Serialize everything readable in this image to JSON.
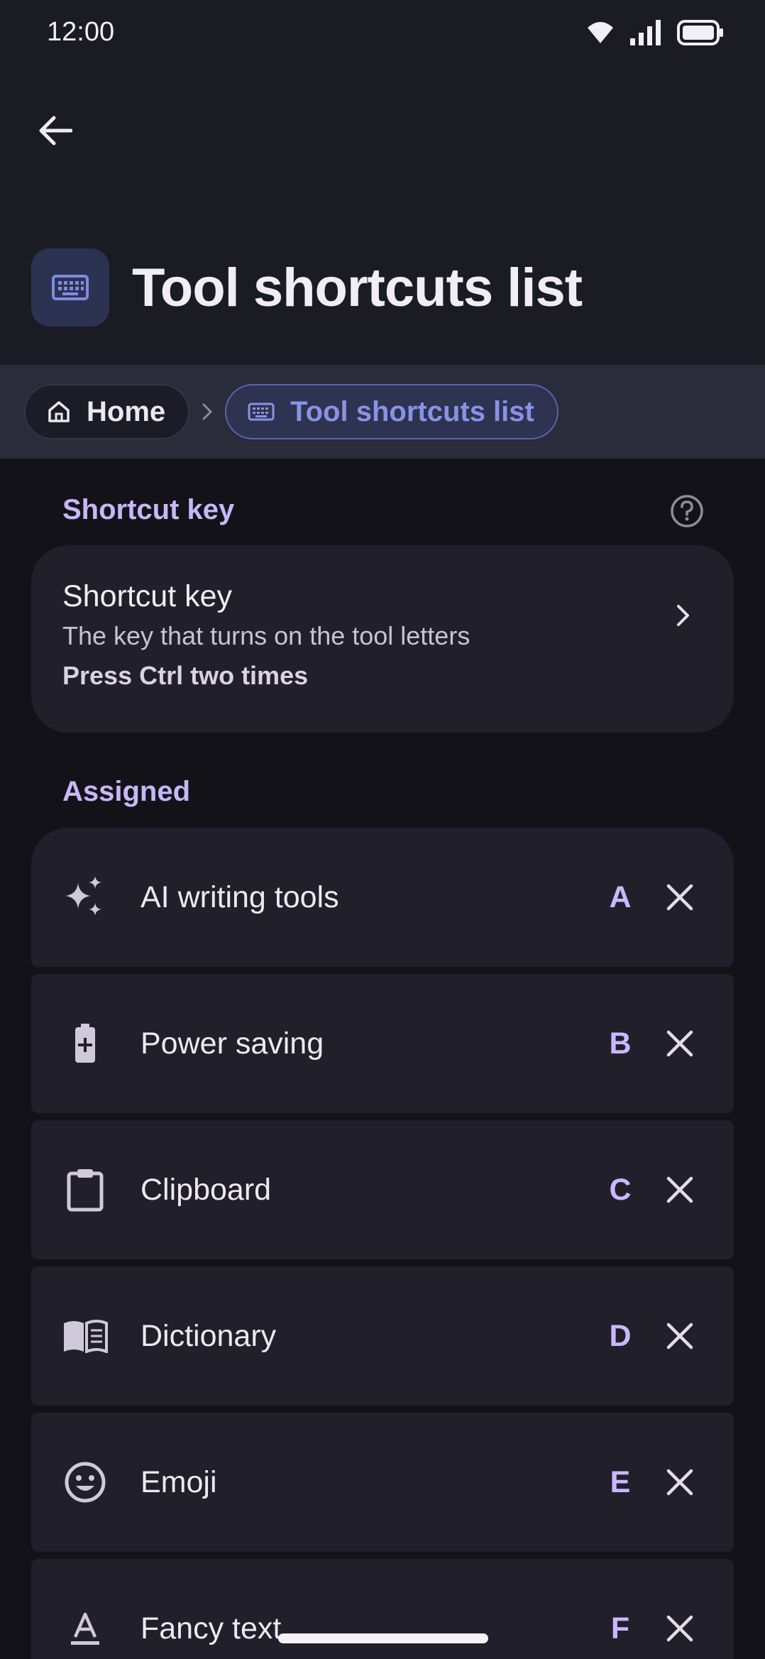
{
  "status_bar": {
    "time": "12:00"
  },
  "header": {
    "title": "Tool shortcuts list"
  },
  "breadcrumb": {
    "home_label": "Home",
    "current_label": "Tool shortcuts list"
  },
  "shortcut_section": {
    "heading": "Shortcut key",
    "card": {
      "title": "Shortcut key",
      "description": "The key that turns on the tool letters",
      "value": "Press Ctrl two times"
    }
  },
  "assigned_section": {
    "heading": "Assigned",
    "items": [
      {
        "label": "AI writing tools",
        "key": "A",
        "icon": "sparkle-icon"
      },
      {
        "label": "Power saving",
        "key": "B",
        "icon": "battery-saver-icon"
      },
      {
        "label": "Clipboard",
        "key": "C",
        "icon": "clipboard-icon"
      },
      {
        "label": "Dictionary",
        "key": "D",
        "icon": "book-icon"
      },
      {
        "label": "Emoji",
        "key": "E",
        "icon": "emoji-icon"
      },
      {
        "label": "Fancy text",
        "key": "F",
        "icon": "text-format-icon"
      }
    ]
  },
  "colors": {
    "accent": "#c7b9ff",
    "breadcrumb_active": "#8893e3",
    "background": "#131219",
    "card": "#211f2a"
  }
}
